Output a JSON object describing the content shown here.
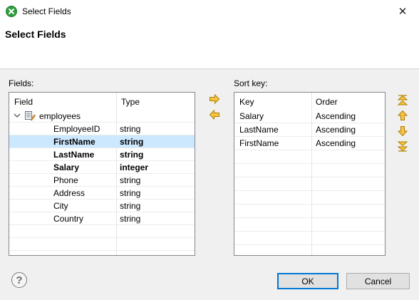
{
  "window": {
    "title": "Select Fields",
    "close_glyph": "✕"
  },
  "header": {
    "title": "Select Fields"
  },
  "fields_panel": {
    "label": "Fields:",
    "columns": [
      "Field",
      "Type"
    ],
    "group": {
      "name": "employees",
      "expanded": true
    },
    "rows": [
      {
        "field": "EmployeeID",
        "type": "string",
        "bold": false,
        "selected": false
      },
      {
        "field": "FirstName",
        "type": "string",
        "bold": true,
        "selected": true
      },
      {
        "field": "LastName",
        "type": "string",
        "bold": true,
        "selected": false
      },
      {
        "field": "Salary",
        "type": "integer",
        "bold": true,
        "selected": false
      },
      {
        "field": "Phone",
        "type": "string",
        "bold": false,
        "selected": false
      },
      {
        "field": "Address",
        "type": "string",
        "bold": false,
        "selected": false
      },
      {
        "field": "City",
        "type": "string",
        "bold": false,
        "selected": false
      },
      {
        "field": "Country",
        "type": "string",
        "bold": false,
        "selected": false
      }
    ]
  },
  "sort_panel": {
    "label": "Sort key:",
    "columns": [
      "Key",
      "Order"
    ],
    "rows": [
      {
        "key": "Salary",
        "order": "Ascending"
      },
      {
        "key": "LastName",
        "order": "Ascending"
      },
      {
        "key": "FirstName",
        "order": "Ascending"
      }
    ]
  },
  "icons": {
    "app": "cloverdx-icon",
    "add": "arrow-right-icon",
    "remove": "arrow-left-icon",
    "move_top": "move-to-top-icon",
    "move_up": "move-up-icon",
    "move_down": "move-down-icon",
    "move_bottom": "move-to-bottom-icon",
    "help": "help-icon"
  },
  "colors": {
    "selection": "#cce8ff",
    "arrow_fill": "#f6c342",
    "arrow_stroke": "#b07d00",
    "default_button_border": "#0078d7"
  },
  "buttons": {
    "ok": "OK",
    "cancel": "Cancel",
    "help": "?"
  }
}
